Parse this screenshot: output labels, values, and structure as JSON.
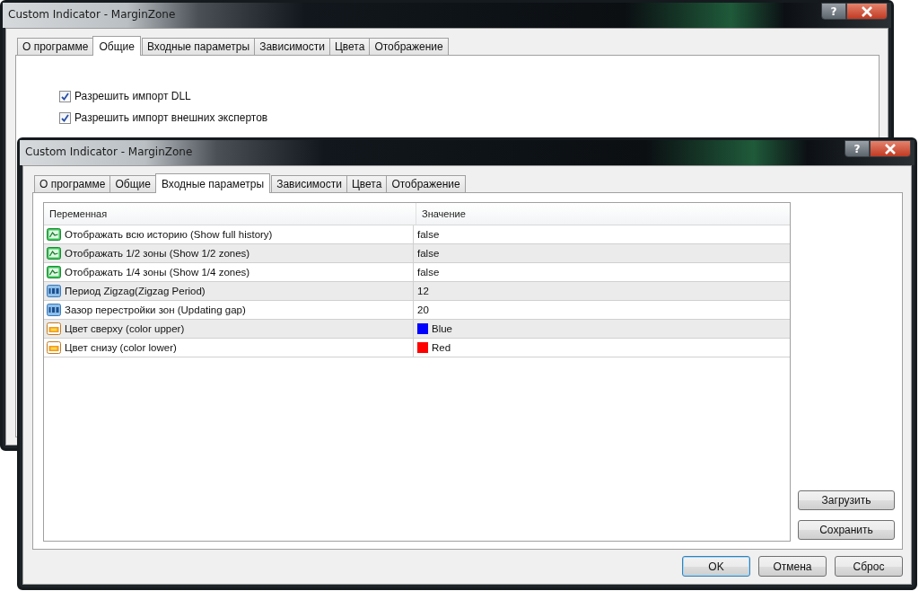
{
  "windows": [
    {
      "kind": "general",
      "title": "Custom Indicator - MarginZone",
      "help_button": "?",
      "tabs": [
        {
          "label": "О программе",
          "selected": false
        },
        {
          "label": "Общие",
          "selected": true
        },
        {
          "label": "Входные параметры",
          "selected": false
        },
        {
          "label": "Зависимости",
          "selected": false
        },
        {
          "label": "Цвета",
          "selected": false
        },
        {
          "label": "Отображение",
          "selected": false
        }
      ],
      "checkboxes": [
        {
          "label": "Разрешить импорт DLL",
          "checked": true
        },
        {
          "label": "Разрешить импорт внешних экспертов",
          "checked": true
        }
      ]
    },
    {
      "kind": "inputs",
      "title": "Custom Indicator - MarginZone",
      "help_button": "?",
      "tabs": [
        {
          "label": "О программе",
          "selected": false
        },
        {
          "label": "Общие",
          "selected": false
        },
        {
          "label": "Входные параметры",
          "selected": true
        },
        {
          "label": "Зависимости",
          "selected": false
        },
        {
          "label": "Цвета",
          "selected": false
        },
        {
          "label": "Отображение",
          "selected": false
        }
      ],
      "table": {
        "columns": [
          "Переменная",
          "Значение"
        ],
        "rows": [
          {
            "kind": "bool",
            "name": "Отображать всю историю (Show full history)",
            "value": "false"
          },
          {
            "kind": "bool",
            "name": "Отображать 1/2 зоны (Show 1/2 zones)",
            "value": "false"
          },
          {
            "kind": "bool",
            "name": "Отображать 1/4 зоны (Show 1/4 zones)",
            "value": "false"
          },
          {
            "kind": "int",
            "name": "Период Zigzag(Zigzag Period)",
            "value": "12"
          },
          {
            "kind": "int",
            "name": "Зазор перестройки зон (Updating gap)",
            "value": "20"
          },
          {
            "kind": "color",
            "name": "Цвет сверху (color upper)",
            "value": "Blue",
            "color": "#0000ff"
          },
          {
            "kind": "color",
            "name": "Цвет снизу (color lower)",
            "value": "Red",
            "color": "#ff0000"
          }
        ]
      },
      "side_buttons": [
        "Загрузить",
        "Сохранить"
      ],
      "buttons": [
        {
          "label": "OK",
          "default": true
        },
        {
          "label": "Отмена",
          "default": false
        },
        {
          "label": "Сброс",
          "default": false
        }
      ]
    }
  ]
}
